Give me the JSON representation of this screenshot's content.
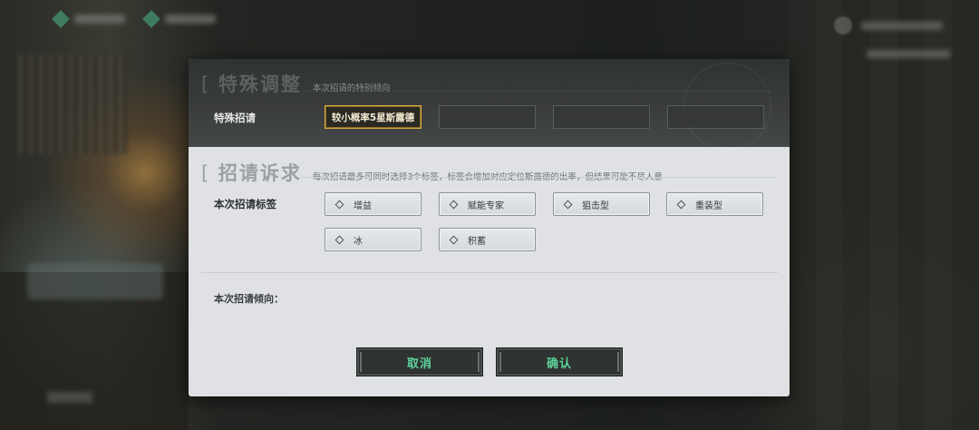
{
  "special": {
    "title": "特殊调整",
    "subtitle": "本次招请的特别倾向",
    "row_label": "特殊招请",
    "slots": [
      "较小概率5星斯露德",
      "",
      "",
      ""
    ]
  },
  "appeal": {
    "title": "招请诉求",
    "subtitle": "每次招请最多可同时选择3个标签，标签会增加对应定位斯露德的出率，但结果可能不尽人意",
    "row_label": "本次招请标签",
    "tags": [
      "增益",
      "赋能专家",
      "狙击型",
      "重装型",
      "冰",
      "积蓄"
    ]
  },
  "tendency": {
    "label": "本次招请倾向："
  },
  "buttons": {
    "cancel": "取消",
    "confirm": "确认"
  },
  "colors": {
    "accent_gold": "#d9ad45",
    "button_text": "#5fd39b",
    "hud_green": "#4bb88b"
  }
}
